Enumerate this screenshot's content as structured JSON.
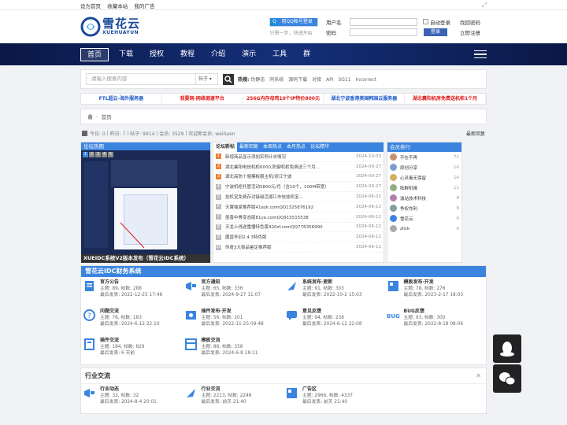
{
  "topbar": {
    "links": [
      "设为首页",
      "收藏本站",
      "我的广告"
    ]
  },
  "logo": {
    "cn": "雪花云",
    "en": "XUEHUAYUN"
  },
  "qq": {
    "button": "用QQ帐号登录",
    "tip": "只需一步，快速开始"
  },
  "login": {
    "user_label": "用户名",
    "pass_label": "密码",
    "auto": "自动登录",
    "forgot": "找回密码",
    "submit": "登录",
    "register": "立即注册"
  },
  "nav": {
    "items": [
      "首页",
      "下载",
      "授权",
      "教程",
      "介绍",
      "演示",
      "工具",
      "群"
    ]
  },
  "search": {
    "placeholder": "请输入搜索内容",
    "select": "帖子",
    "hot_label": "热搜:",
    "hot": [
      "伪静态",
      "同系统",
      "源码下载",
      "对接",
      "API",
      "SG11",
      "Incorrect"
    ]
  },
  "ads": [
    {
      "text": "FTL超云-海外服务器",
      "color": "#1a56c8"
    },
    {
      "text": "我要网-网络测速平台",
      "color": "#e01818"
    },
    {
      "text": "256G内存母鸡10个IP特价800元",
      "color": "#e01818"
    },
    {
      "text": "湖北宁波香港美国韩国云服务器",
      "color": "#1a56c8"
    },
    {
      "text": "湖北襄阳机房免费送机柜1个月",
      "color": "#e01818"
    }
  ],
  "crumb": {
    "home": "首页"
  },
  "stats": {
    "today": "今日: 0",
    "yesterday": "昨日: 7",
    "posts": "帖子: 9914",
    "members": "会员: 3529",
    "welcome": "欢迎新会员: weihaen",
    "latest": "最新回复"
  },
  "slides": {
    "title": "论坛热图",
    "caption": "XUEIDC系统V2版本发布（雪花云IDC系统）",
    "pages": [
      "1",
      "2",
      "3",
      "4",
      "5"
    ]
  },
  "newest": {
    "tabs": [
      "论坛新帖",
      "最新回复",
      "本周热点",
      "本月热点",
      "论坛精华"
    ],
    "threads": [
      {
        "n": "1",
        "t": "新增商品显示添加实例计去情况",
        "d": "2024-10-03"
      },
      {
        "n": "2",
        "t": "湖北襄阳电信机柜6000,防御机柜免费送三个月...",
        "d": "2024-09-27"
      },
      {
        "n": "3",
        "t": "湖北高防十堰模板服主机/浙江宁波",
        "d": "2024-09-27"
      },
      {
        "n": "4",
        "t": "宁波机柜托管活动5800元/月（含10个，100M带宽）",
        "d": "2024-09-27"
      },
      {
        "n": "5",
        "t": "挂机宝免费存对接磁活湖江市信挂机宝...",
        "d": "2024-06-21"
      },
      {
        "n": "6",
        "t": "天翼独家推荐版41ezk.comQQ1325876192",
        "d": "2024-06-12"
      },
      {
        "n": "7",
        "t": "墨香中骨变态版81ye.comQQ915515538",
        "d": "2024-06-12"
      },
      {
        "n": "8",
        "t": "天龙上线送重播特色版420zf.comQQ776356990",
        "d": "2024-06-12"
      },
      {
        "n": "9",
        "t": "魔兽怀旧2.4.3特色版",
        "d": "2024-06-11"
      },
      {
        "n": "10",
        "t": "传奇3大极品鉴定推荐版",
        "d": "2024-06-11"
      }
    ]
  },
  "rank": {
    "title": "会员排行",
    "members": [
      {
        "name": "不在不再",
        "score": "71"
      },
      {
        "name": "原创分享",
        "score": "14"
      },
      {
        "name": "心灵毒无保留",
        "score": "14"
      },
      {
        "name": "陆群机推",
        "score": "11"
      },
      {
        "name": "渝站技术科技",
        "score": "8"
      },
      {
        "name": "争权夺利",
        "score": "8"
      },
      {
        "name": "雪花云",
        "score": "6"
      },
      {
        "name": "zlick",
        "score": "6"
      }
    ]
  },
  "section1": {
    "title": "雪花云IDC财务系统",
    "forums": [
      {
        "name": "官方公告",
        "stats": "主题: 89, 帖数: 288",
        "last": "最后发表: 2022-12-25 17:46",
        "color": "#3a84e0"
      },
      {
        "name": "官方通知",
        "stats": "主题: 65, 帖数: 336",
        "last": "最后发表: 2024-9-27 11:07",
        "color": "#3a84e0"
      },
      {
        "name": "系统发布·更新",
        "stats": "主题: 91, 帖数: 303",
        "last": "最后发表: 2022-10-2 15:03",
        "color": "#3a84e0"
      },
      {
        "name": "模板发布·开发",
        "stats": "主题: 78, 帖数: 276",
        "last": "最后发表: 2023-2-17 18:03",
        "color": "#3a84e0"
      },
      {
        "name": "问题交流",
        "stats": "主题: 76, 帖数: 183",
        "last": "最后发表: 2024-6-12 22:10",
        "color": "#3a84e0"
      },
      {
        "name": "插件发布·开发",
        "stats": "主题: 56, 帖数: 201",
        "last": "最后发表: 2022-11-25 09:48",
        "color": "#3a84e0"
      },
      {
        "name": "意见反馈",
        "stats": "主题: 94, 帖数: 238",
        "last": "最后发表: 2024-6-12 22:08",
        "color": "#3a84e0"
      },
      {
        "name": "BUG反馈",
        "stats": "主题: 93, 帖数: 300",
        "last": "最后发表: 2022-8-18 08:06",
        "color": "#3a84e0"
      },
      {
        "name": "插件交流",
        "stats": "主题: 184, 帖数: 829",
        "last": "最后发表: 6 天前",
        "color": "#3a84e0"
      },
      {
        "name": "模板交流",
        "stats": "主题: 88, 帖数: 338",
        "last": "最后发表: 2024-6-8 18:11",
        "color": "#3a84e0"
      }
    ]
  },
  "section2": {
    "title": "行业交流",
    "collapse": "✕",
    "forums": [
      {
        "name": "行业动态",
        "stats": "主题: 32, 帖数: 32",
        "last": "最后发表: 2024-8-4 20:01"
      },
      {
        "name": "行业交流",
        "stats": "主题: 2213, 帖数: 2248",
        "last": "最后发表: 前天 21:40"
      },
      {
        "name": "广告区",
        "stats": "主题: 2966, 帖数: 4337",
        "last": "最后发表: 前天 21:40"
      }
    ]
  }
}
